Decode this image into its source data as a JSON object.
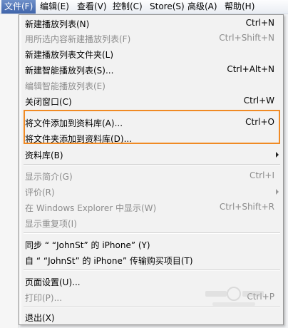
{
  "menubar": {
    "file": "文件(F)",
    "edit": "编辑(E)",
    "view": "查看(V)",
    "control": "控制(C)",
    "store": "Store(S)",
    "advanced": "高级(A)",
    "help": "帮助(H)"
  },
  "file_menu": {
    "new_playlist": {
      "label": "新建播放列表(N)",
      "shortcut": "Ctrl+N"
    },
    "new_playlist_from_selection": {
      "label": "用所选内容新建播放列表(F)",
      "shortcut": "Ctrl+Shift+N"
    },
    "new_playlist_folder": {
      "label": "新建播放列表文件夹(L)"
    },
    "new_smart_playlist": {
      "label": "新建智能播放列表(S)...",
      "shortcut": "Ctrl+Alt+N"
    },
    "edit_smart_playlist": {
      "label": "编辑智能播放列表(E)"
    },
    "close_window": {
      "label": "关闭窗口(C)",
      "shortcut": "Ctrl+W"
    },
    "add_file_to_library": {
      "label": "将文件添加到资料库(A)...",
      "shortcut": "Ctrl+O"
    },
    "add_folder_to_library": {
      "label": "将文件夹添加到资料库(D)..."
    },
    "library": {
      "label": "资料库(B)"
    },
    "get_info": {
      "label": "显示简介(G)",
      "shortcut": "Ctrl+I"
    },
    "rating": {
      "label": "评价(R)"
    },
    "show_in_explorer": {
      "label": "在 Windows Explorer 中显示(W)",
      "shortcut": "Ctrl+Shift+R"
    },
    "show_duplicates": {
      "label": "显示重复项(I)"
    },
    "sync": {
      "label": "同步 “ “JohnSt” 的 iPhone” (Y)"
    },
    "transfer_purchases": {
      "label": "自 “ “JohnSt” 的 iPhone” 传输购买项目(T)"
    },
    "page_setup": {
      "label": "页面设置(U)..."
    },
    "print": {
      "label": "打印(P)...",
      "shortcut": "Ctrl+P"
    },
    "exit": {
      "label": "退出(X)"
    }
  },
  "colors": {
    "highlight_border": "#f08a24",
    "menubar_active": "#4a6fb3",
    "disabled_text": "#8d8d8d"
  }
}
